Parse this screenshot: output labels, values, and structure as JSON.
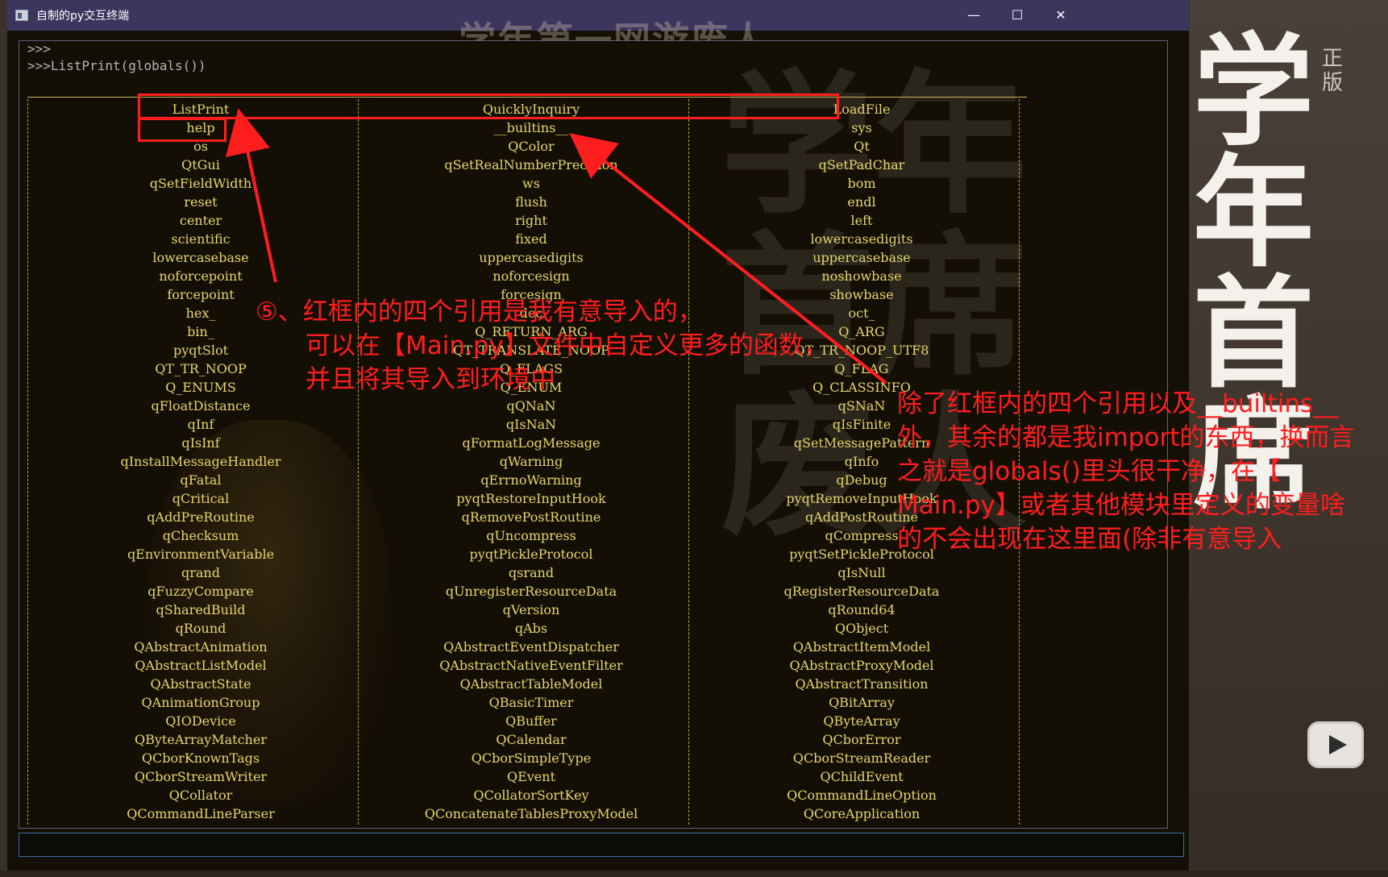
{
  "window": {
    "title": "自制的py交互终端",
    "title_overlay": "学年第一网游废人",
    "minimize_glyph": "—",
    "maximize_glyph": "☐",
    "close_glyph": "✕"
  },
  "video": {
    "watermark_big": "学年首席",
    "watermark_edition": "正版",
    "bg_watermark": "学年首席废人"
  },
  "console": {
    "prompt_empty": ">>>",
    "prompt_command": ">>>ListPrint(globals())",
    "rows": [
      [
        "ListPrint",
        "QuicklyInquiry",
        "LoadFile"
      ],
      [
        "help",
        "__builtins__",
        "sys"
      ],
      [
        "os",
        "QColor",
        "Qt"
      ],
      [
        "QtGui",
        "qSetRealNumberPrecision",
        "qSetPadChar"
      ],
      [
        "qSetFieldWidth",
        "ws",
        "bom"
      ],
      [
        "reset",
        "flush",
        "endl"
      ],
      [
        "center",
        "right",
        "left"
      ],
      [
        "scientific",
        "fixed",
        "lowercasedigits"
      ],
      [
        "lowercasebase",
        "uppercasedigits",
        "uppercasebase"
      ],
      [
        "noforcepoint",
        "noforcesign",
        "noshowbase"
      ],
      [
        "forcepoint",
        "forcesign",
        "showbase"
      ],
      [
        "hex_",
        "dec",
        "oct_"
      ],
      [
        "bin_",
        "Q_RETURN_ARG",
        "Q_ARG"
      ],
      [
        "pyqtSlot",
        "QT_TRANSLATE_NOOP",
        "QT_TR_NOOP_UTF8"
      ],
      [
        "QT_TR_NOOP",
        "Q_FLAGS",
        "Q_FLAG"
      ],
      [
        "Q_ENUMS",
        "Q_ENUM",
        "Q_CLASSINFO"
      ],
      [
        "qFloatDistance",
        "qQNaN",
        "qSNaN"
      ],
      [
        "qInf",
        "qIsNaN",
        "qIsFinite"
      ],
      [
        "qIsInf",
        "qFormatLogMessage",
        "qSetMessagePattern"
      ],
      [
        "qInstallMessageHandler",
        "qWarning",
        "qInfo"
      ],
      [
        "qFatal",
        "qErrnoWarning",
        "qDebug"
      ],
      [
        "qCritical",
        "pyqtRestoreInputHook",
        "pyqtRemoveInputHook"
      ],
      [
        "qAddPreRoutine",
        "qRemovePostRoutine",
        "qAddPostRoutine"
      ],
      [
        "qChecksum",
        "qUncompress",
        "qCompress"
      ],
      [
        "qEnvironmentVariable",
        "pyqtPickleProtocol",
        "pyqtSetPickleProtocol"
      ],
      [
        "qrand",
        "qsrand",
        "qIsNull"
      ],
      [
        "qFuzzyCompare",
        "qUnregisterResourceData",
        "qRegisterResourceData"
      ],
      [
        "qSharedBuild",
        "qVersion",
        "qRound64"
      ],
      [
        "qRound",
        "qAbs",
        "QObject"
      ],
      [
        "QAbstractAnimation",
        "QAbstractEventDispatcher",
        "QAbstractItemModel"
      ],
      [
        "QAbstractListModel",
        "QAbstractNativeEventFilter",
        "QAbstractProxyModel"
      ],
      [
        "QAbstractState",
        "QAbstractTableModel",
        "QAbstractTransition"
      ],
      [
        "QAnimationGroup",
        "QBasicTimer",
        "QBitArray"
      ],
      [
        "QIODevice",
        "QBuffer",
        "QByteArray"
      ],
      [
        "QByteArrayMatcher",
        "QCalendar",
        "QCborError"
      ],
      [
        "QCborKnownTags",
        "QCborSimpleType",
        "QCborStreamReader"
      ],
      [
        "QCborStreamWriter",
        "QEvent",
        "QChildEvent"
      ],
      [
        "QCollator",
        "QCollatorSortKey",
        "QCommandLineOption"
      ],
      [
        "QCommandLineParser",
        "QConcatenateTablesProxyModel",
        "QCoreApplication"
      ]
    ],
    "input_value": ""
  },
  "annotations": {
    "note_left": [
      "⑤、红框内的四个引用是我有意导入的，",
      "可以在【Main.py】文件中自定义更多的函数，",
      "并且将其导入到环境中"
    ],
    "note_right": [
      "除了红框内的四个引用以及__builtins__",
      "外，其余的都是我import的东西，换而言",
      "之就是globals()里头很干净，在【",
      "Main.py】或者其他模块里定义的变量啥",
      "的不会出现在这里面(除非有意导入"
    ]
  },
  "colors": {
    "titlebar": "#3c355e",
    "console_bg": "#140f05",
    "output_text": "#e6d66c",
    "annotation_red": "#ff1e1e"
  },
  "icons": [
    "terminal-app-icon",
    "minimize-icon",
    "maximize-icon",
    "close-icon",
    "scroll-up-arrow-icon",
    "scroll-down-arrow-icon",
    "play-logo-icon"
  ]
}
